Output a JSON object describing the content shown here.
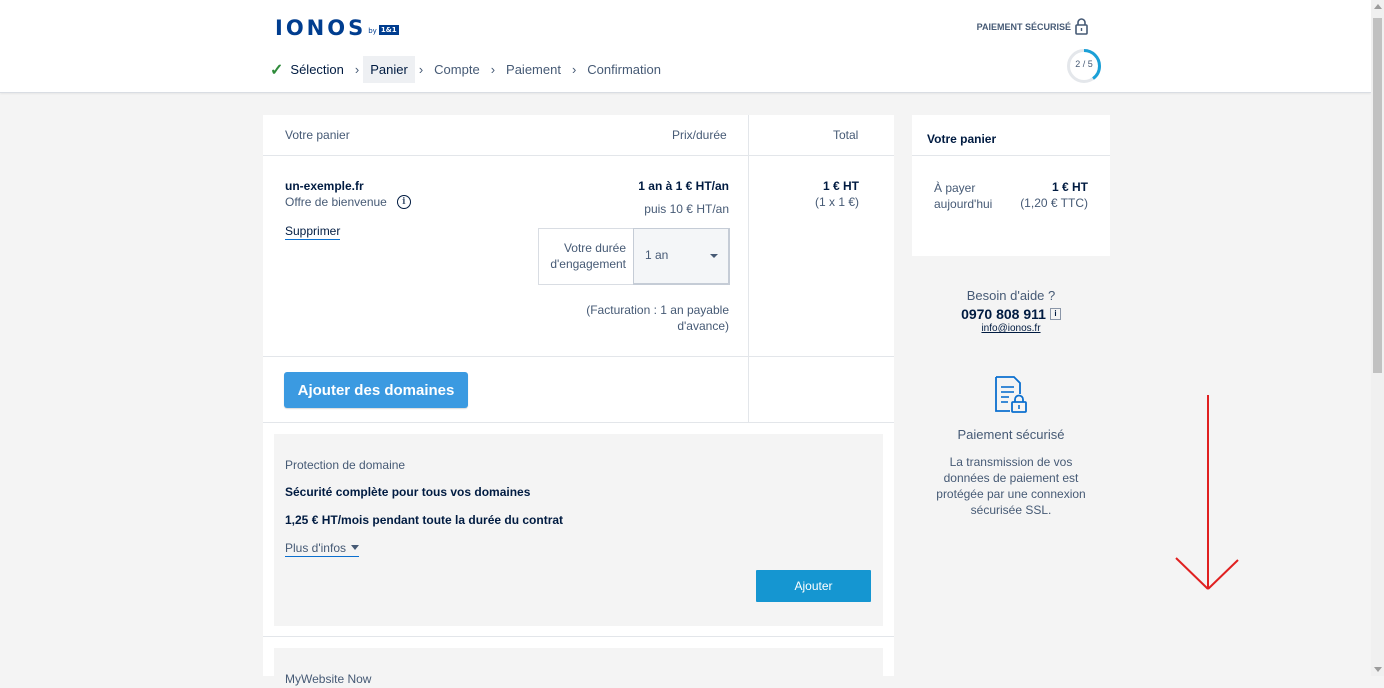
{
  "header": {
    "logo_text": "IONOS",
    "logo_by": "by",
    "logo_box": "1&1",
    "secure_label": "PAIEMENT SÉCURISÉ",
    "progress_label": "2 / 5",
    "progress_value": 0.4,
    "steps": [
      {
        "label": "Sélection"
      },
      {
        "label": "Panier"
      },
      {
        "label": "Compte"
      },
      {
        "label": "Paiement"
      },
      {
        "label": "Confirmation"
      }
    ]
  },
  "cart": {
    "col_cart": "Votre panier",
    "col_price": "Prix/durée",
    "col_total": "Total",
    "item": {
      "domain": "un-exemple.fr",
      "offer": "Offre de bienvenue",
      "delete": "Supprimer",
      "price_line1": "1 an à 1 € HT/an",
      "price_line2": "puis 10 € HT/an",
      "duration_label": "Votre durée d'engagement",
      "duration_value": "1 an",
      "billing": "(Facturation : 1 an payable d'avance)",
      "total": "1 € HT",
      "total_detail": "(1 x 1 €)"
    },
    "add_domains": "Ajouter des domaines",
    "upsell": {
      "title": "Protection de domaine",
      "headline": "Sécurité complète pour tous vos domaines",
      "price": "1,25 € HT/mois pendant toute la durée du contrat",
      "more_info": "Plus d'infos",
      "add": "Ajouter"
    },
    "next_upsell_title": "MyWebsite Now"
  },
  "summary": {
    "title": "Votre panier",
    "pay_today_label": "À payer aujourd'hui",
    "pay_today_value": "1 € HT",
    "pay_today_ttc": "(1,20 € TTC)"
  },
  "help": {
    "title": "Besoin d'aide ?",
    "phone": "0970 808 911",
    "email": "info@ionos.fr"
  },
  "secure_payment": {
    "title": "Paiement sécurisé",
    "text": "La transmission de vos données de paiement est protégée par une connexion sécurisée SSL."
  },
  "colors": {
    "brand": "#003d8f",
    "primary_button": "#3b9ae1",
    "add_button": "#1596d1",
    "progress": "#1ba0d7",
    "annotation_arrow": "#e02020"
  }
}
